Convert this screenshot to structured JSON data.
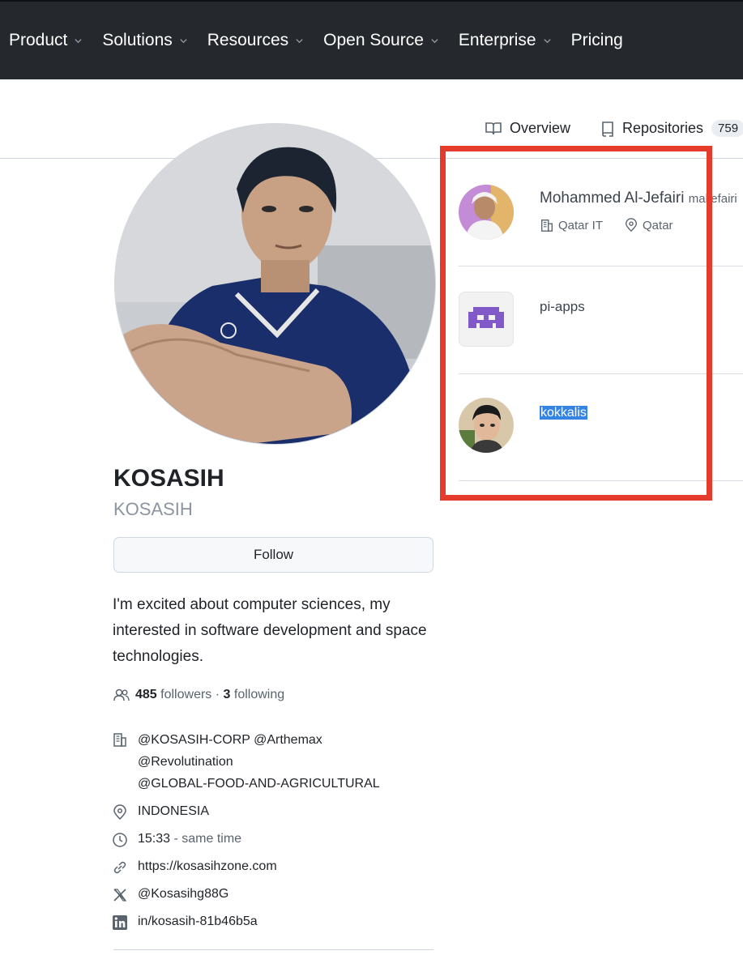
{
  "nav": {
    "items": [
      {
        "label": "Product",
        "dropdown": true
      },
      {
        "label": "Solutions",
        "dropdown": true
      },
      {
        "label": "Resources",
        "dropdown": true
      },
      {
        "label": "Open Source",
        "dropdown": true
      },
      {
        "label": "Enterprise",
        "dropdown": true
      },
      {
        "label": "Pricing",
        "dropdown": false
      }
    ]
  },
  "tabs": {
    "overview": "Overview",
    "repositories": "Repositories",
    "repositories_count": "759"
  },
  "profile": {
    "name": "KOSASIH",
    "username": "KOSASIH",
    "follow_label": "Follow",
    "bio": "I'm excited about computer sciences, my interested in software development and space technologies.",
    "followers_count": "485",
    "followers_label": "followers",
    "separator": "·",
    "following_count": "3",
    "following_label": "following",
    "orgs": [
      "@KOSASIH-CORP @Arthemax",
      "@Revolutination",
      "@GLOBAL-FOOD-AND-AGRICULTURAL"
    ],
    "location": "INDONESIA",
    "local_time": "15:33",
    "time_note": "- same time",
    "website": "https://kosasihzone.com",
    "x_handle": "@Kosasihg88G",
    "linkedin": "in/kosasih-81b46b5a"
  },
  "following_list": [
    {
      "name": "Mohammed Al-Jefairi",
      "handle": "maljefairi",
      "company": "Qatar IT",
      "location": "Qatar",
      "avatar": "person-photo"
    },
    {
      "name": "pi-apps",
      "avatar": "pixel-invader-logo"
    },
    {
      "name": "kokkalis",
      "avatar": "person-photo",
      "selected": true
    }
  ],
  "colors": {
    "nav_bg": "#25292e",
    "highlight": "#3584e4",
    "annotation_box": "#e53b2d",
    "pi_apps_purple": "#8159c8"
  }
}
